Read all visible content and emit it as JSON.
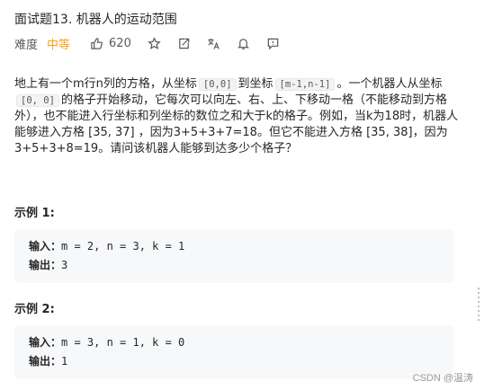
{
  "problem": {
    "title": "面试题13. 机器人的运动范围",
    "difficulty_label": "难度",
    "difficulty": "中等",
    "likes": "620"
  },
  "toolbar_icons": [
    "thumbs-up-icon",
    "star-icon",
    "share-icon",
    "translate-icon",
    "bell-icon",
    "feedback-icon"
  ],
  "description": {
    "p1": "地上有一个m行n列的方格，从坐标",
    "code1": "[0,0]",
    "p2": "到坐标",
    "code2": "[m-1,n-1]",
    "p3": "。一个机器人从坐标",
    "code3": "[0, 0]",
    "p4": "的格子开始移动，它每次可以向左、右、上、下移动一格（不能移动到方格外），也不能进入行坐标和列坐标的数位之和大于k的格子。例如，当k为18时，机器人能够进入方格 [35, 37] ，因为3+5+3+7=18。但它不能进入方格 [35, 38]，因为3+5+3+8=19。请问该机器人能够到达多少个格子？"
  },
  "examples": [
    {
      "title": "示例 1:",
      "input_label": "输入：",
      "input_value": "m = 2, n = 3, k = 1",
      "output_label": "输出：",
      "output_value": "3"
    },
    {
      "title": "示例 2:",
      "input_label": "输入：",
      "input_value": "m = 3, n = 1, k = 0",
      "output_label": "输出：",
      "output_value": "1"
    }
  ],
  "watermark": "CSDN @温涛",
  "colors": {
    "difficulty_medium": "#ffa116",
    "example_bg": "#f7f8fa"
  }
}
